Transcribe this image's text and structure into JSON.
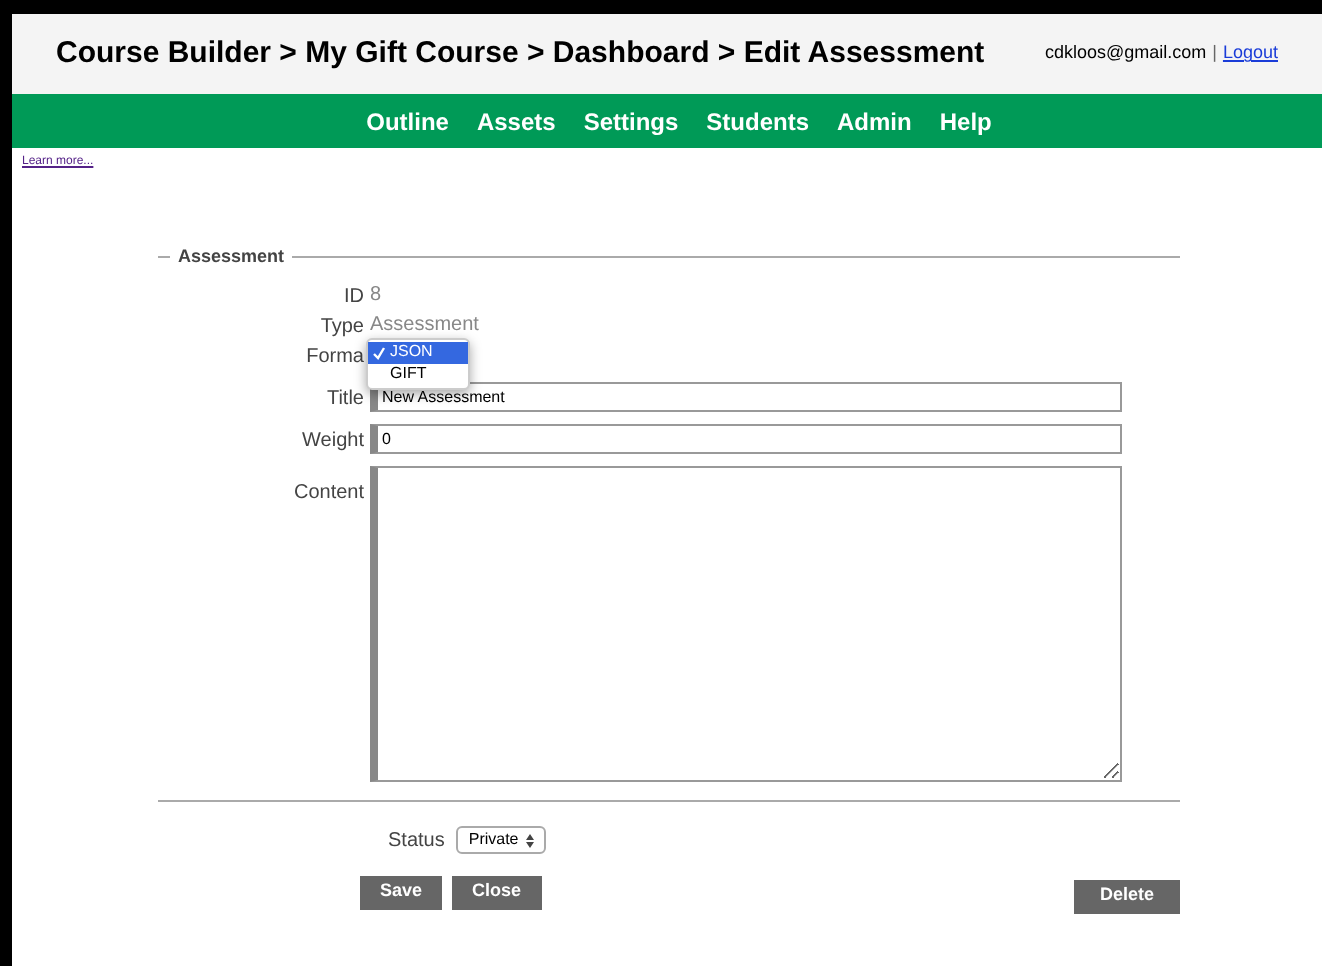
{
  "header": {
    "breadcrumb": "Course Builder > My Gift Course > Dashboard > Edit Assessment",
    "email": "cdkloos@gmail.com",
    "separator": "|",
    "logout": "Logout"
  },
  "nav": [
    "Outline",
    "Assets",
    "Settings",
    "Students",
    "Admin",
    "Help"
  ],
  "learn_more": "Learn more...",
  "form": {
    "legend": "Assessment",
    "fields": [
      {
        "kind": "text",
        "label": "ID",
        "value": "8"
      },
      {
        "kind": "text",
        "label": "Type",
        "value": "Assessment"
      },
      {
        "kind": "dropdown",
        "label": "Forma",
        "options": [
          {
            "label": "JSON",
            "selected": true
          },
          {
            "label": "GIFT",
            "selected": false
          }
        ]
      },
      {
        "kind": "input",
        "label": "Title",
        "value": "New Assessment"
      },
      {
        "kind": "input",
        "label": "Weight",
        "value": "0"
      },
      {
        "kind": "textarea",
        "label": "Content"
      }
    ]
  },
  "status": {
    "label": "Status",
    "value": "Private"
  },
  "buttons": [
    "Save",
    "Close"
  ],
  "delete_button": "Delete"
}
